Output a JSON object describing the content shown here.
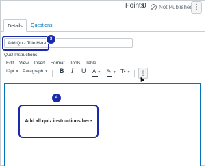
{
  "header": {
    "points_label": "Points",
    "points_value": "0",
    "status_text": "Not Published",
    "more_icon": "kebab-vertical-icon"
  },
  "tabs": [
    {
      "label": "Details",
      "active": true
    },
    {
      "label": "Questions",
      "active": false
    }
  ],
  "quiz_title": {
    "value": "Add Quiz Title Here",
    "callout_number": "3"
  },
  "instructions": {
    "label": "Quiz Instructions:",
    "menu": [
      "Edit",
      "View",
      "Insert",
      "Format",
      "Tools",
      "Table"
    ],
    "toolbar": {
      "font_size": "12pt",
      "block_format": "Paragraph",
      "bold": "B",
      "italic": "I",
      "underline": "U",
      "text_color_icon": "A",
      "highlight_icon": "✎",
      "superscript": "T²"
    },
    "callout_number": "4",
    "callout_text": "Add all quiz instructions here"
  },
  "colors": {
    "callout_border": "#1a2aa8",
    "link": "#0374b5",
    "editor_focus": "#0374b5"
  }
}
